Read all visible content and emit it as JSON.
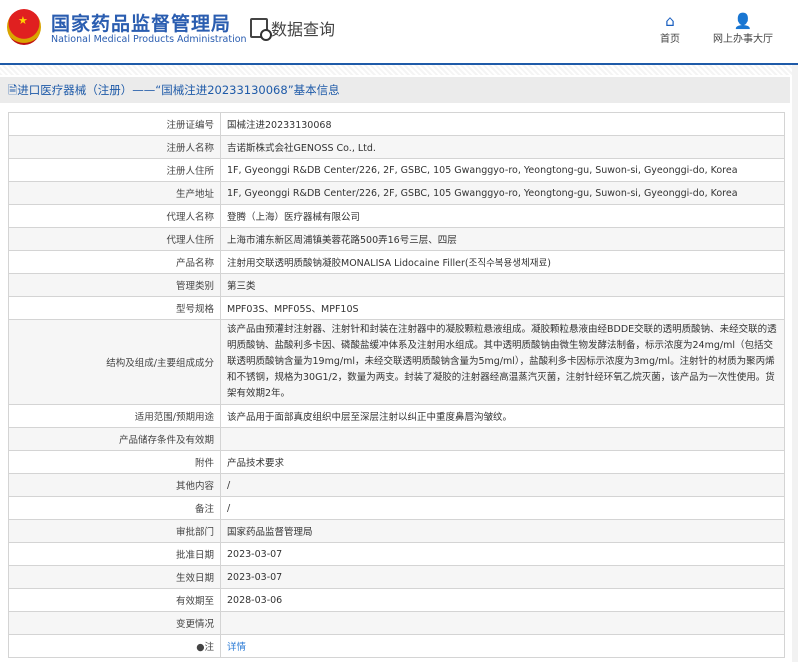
{
  "header": {
    "logo_cn": "国家药品监督管理局",
    "logo_en": "National Medical Products Administration",
    "section": "数据查询",
    "nav": [
      {
        "label": "首页",
        "icon": "home-icon"
      },
      {
        "label": "网上办事大厅",
        "icon": "user-icon"
      }
    ]
  },
  "title": "进口医疗器械（注册）——“国械注进20233130068”基本信息",
  "rows": [
    {
      "label": "注册证编号",
      "value": "国械注进20233130068"
    },
    {
      "label": "注册人名称",
      "value": "吉诺斯株式会社GENOSS Co., Ltd."
    },
    {
      "label": "注册人住所",
      "value": "1F, Gyeonggi R&DB Center/226, 2F, GSBC, 105 Gwanggyo-ro, Yeongtong-gu, Suwon-si, Gyeonggi-do, Korea"
    },
    {
      "label": "生产地址",
      "value": "1F, Gyeonggi R&DB Center/226, 2F, GSBC, 105 Gwanggyo-ro, Yeongtong-gu, Suwon-si, Gyeonggi-do, Korea"
    },
    {
      "label": "代理人名称",
      "value": "登腾（上海）医疗器械有限公司"
    },
    {
      "label": "代理人住所",
      "value": "上海市浦东新区周浦镇美蓉花路500弄16号三层、四层"
    },
    {
      "label": "产品名称",
      "value": "注射用交联透明质酸钠凝胶MONALISA Lidocaine Filler(조직수복용생체재료)"
    },
    {
      "label": "管理类别",
      "value": "第三类"
    },
    {
      "label": "型号规格",
      "value": "MPF03S、MPF05S、MPF10S"
    },
    {
      "label": "结构及组成/主要组成成分",
      "value": "该产品由预灌封注射器、注射针和封装在注射器中的凝胶颗粒悬液组成。凝胶颗粒悬液由经BDDE交联的透明质酸钠、未经交联的透明质酸钠、盐酸利多卡因、磷酸盐缓冲体系及注射用水组成。其中透明质酸钠由微生物发酵法制备，标示浓度为24mg/ml（包括交联透明质酸钠含量为19mg/ml，未经交联透明质酸钠含量为5mg/ml），盐酸利多卡因标示浓度为3mg/ml。注射针的材质为聚丙烯和不锈钢，规格为30G1/2，数量为两支。封装了凝胶的注射器经高温蒸汽灭菌，注射针经环氧乙烷灭菌，该产品为一次性使用。货架有效期2年。"
    },
    {
      "label": "适用范围/预期用途",
      "value": "该产品用于面部真皮组织中层至深层注射以纠正中重度鼻唇沟皱纹。"
    },
    {
      "label": "产品储存条件及有效期",
      "value": ""
    },
    {
      "label": "附件",
      "value": "产品技术要求"
    },
    {
      "label": "其他内容",
      "value": "/"
    },
    {
      "label": "备注",
      "value": "/"
    },
    {
      "label": "审批部门",
      "value": "国家药品监督管理局"
    },
    {
      "label": "批准日期",
      "value": "2023-03-07"
    },
    {
      "label": "生效日期",
      "value": "2023-03-07"
    },
    {
      "label": "有效期至",
      "value": "2028-03-06"
    },
    {
      "label": "变更情况",
      "value": ""
    }
  ],
  "note": {
    "label": "注",
    "link": "详情"
  }
}
